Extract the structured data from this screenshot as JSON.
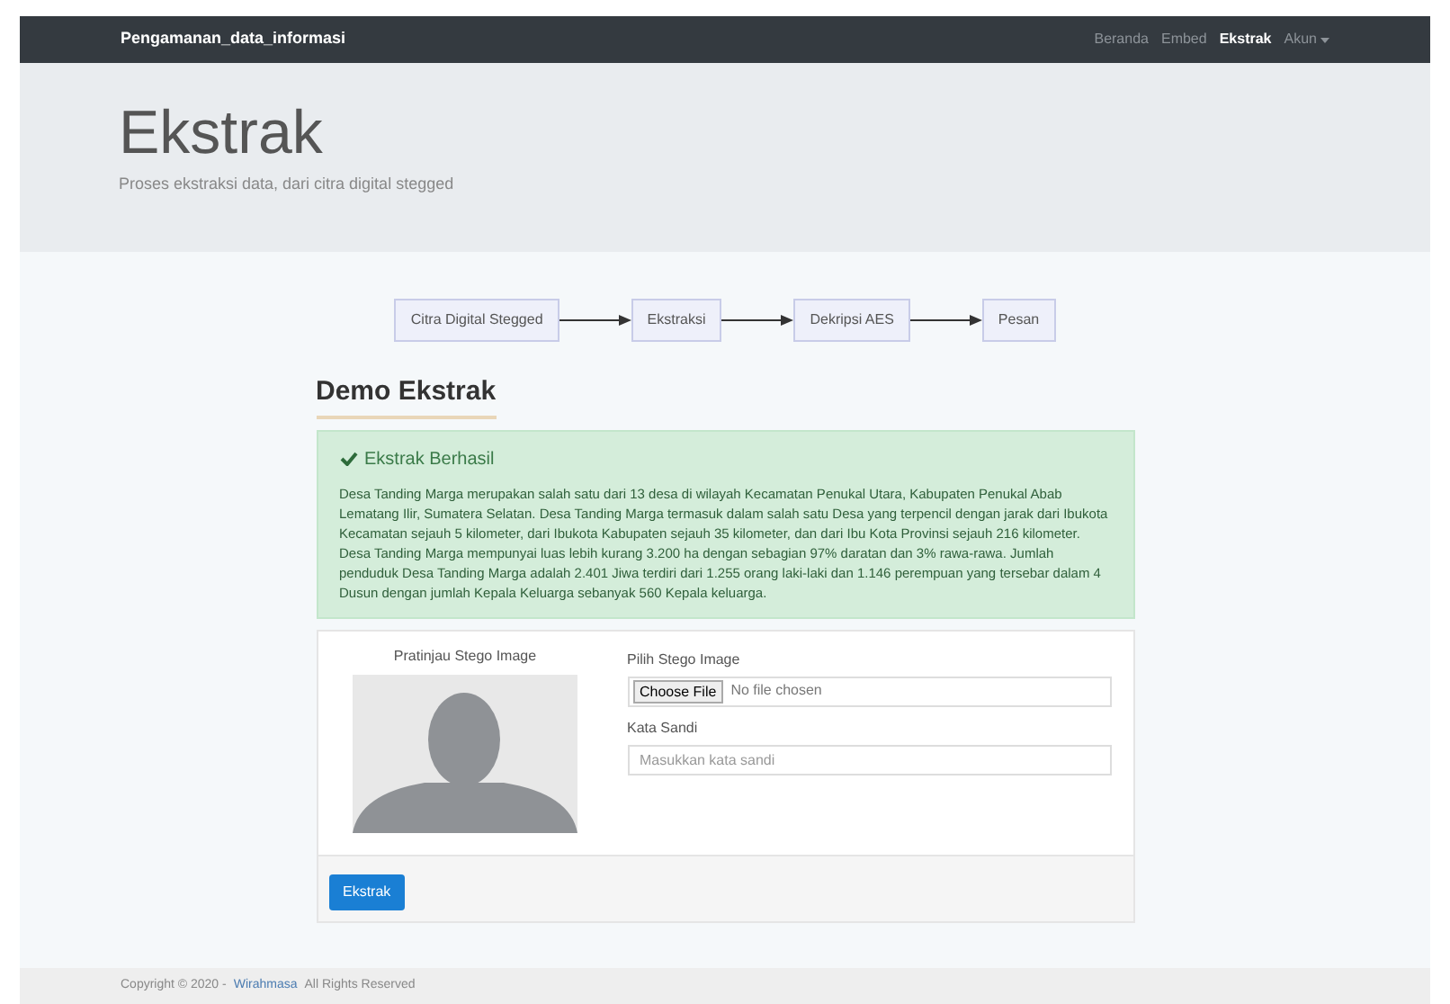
{
  "navbar": {
    "brand": "Pengamanan_data_informasi",
    "links": [
      {
        "label": "Beranda",
        "selected": false
      },
      {
        "label": "Embed",
        "selected": false
      },
      {
        "label": "Ekstrak",
        "selected": true
      },
      {
        "label": "Akun",
        "selected": false,
        "kind": "dropdown"
      }
    ]
  },
  "header": {
    "title": "Ekstrak",
    "subtitle": "Proses ekstraksi data, dari citra digital stegged"
  },
  "flow": [
    "Citra Digital Stegged",
    "Ekstraksi",
    "Dekripsi AES",
    "Pesan"
  ],
  "section_title": "Demo Ekstrak",
  "alert": {
    "title": "Ekstrak Berhasil",
    "message": "Desa Tanding Marga merupakan salah satu dari 13 desa di wilayah Kecamatan Penukal Utara, Kabupaten Penukal Abab Lematang Ilir, Sumatera Selatan. Desa Tanding Marga termasuk dalam salah satu Desa yang terpencil dengan jarak dari Ibukota Kecamatan sejauh 5 kilometer, dari Ibukota Kabupaten sejauh 35 kilometer, dan dari Ibu Kota Provinsi sejauh 216 kilometer. Desa Tanding Marga mempunyai luas lebih kurang 3.200 ha dengan sebagian 97% daratan dan 3% rawa-rawa. Jumlah penduduk Desa Tanding Marga adalah 2.401 Jiwa terdiri dari 1.255 orang laki-laki dan 1.146 perempuan yang tersebar dalam 4 Dusun dengan jumlah Kepala Keluarga sebanyak 560 Kepala keluarga."
  },
  "preview": {
    "label": "Pratinjau Stego Image"
  },
  "file_field": {
    "label": "Pilih Stego Image",
    "button": "Choose File",
    "status": "No file chosen"
  },
  "password_field": {
    "label": "Kata Sandi",
    "placeholder": "Masukkan kata sandi"
  },
  "submit": "Ekstrak",
  "footer": {
    "text": "Copyright © 2020 -",
    "link": "Wirahmasa",
    "suffix": "All Rights Reserved"
  }
}
